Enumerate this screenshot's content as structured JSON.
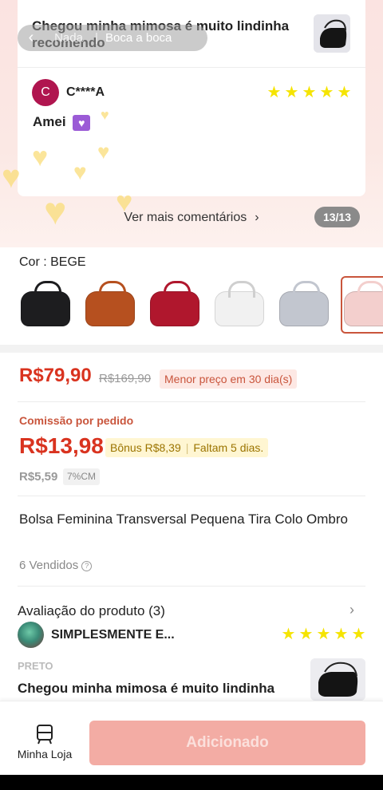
{
  "header_tabs": {
    "back_icon": "chevron-left-icon",
    "tab1": "Nada",
    "tab2": "Boca a boca"
  },
  "top_review": {
    "title": "Chegou minha mimosa é muito lindinha recomendo"
  },
  "comment": {
    "avatar_letter": "C",
    "user": "C****A",
    "rating": 5,
    "text": "Amei",
    "emoji": "purple-heart-icon"
  },
  "see_more": {
    "label": "Ver mais comentários",
    "counter": "13/13"
  },
  "color": {
    "label": "Cor : BEGE",
    "swatches": [
      {
        "name": "preto",
        "color": "#1d1d1f"
      },
      {
        "name": "marrom",
        "color": "#b6501f"
      },
      {
        "name": "vermelho",
        "color": "#b0172d"
      },
      {
        "name": "branco",
        "color": "#f1f1f1"
      },
      {
        "name": "cinza",
        "color": "#c2c6cf"
      },
      {
        "name": "bege",
        "color": "#f3cfcd",
        "selected": true
      }
    ]
  },
  "pricing": {
    "price": "R$79,90",
    "old_price": "R$169,90",
    "lowest_badge": "Menor preço em 30 dia(s)",
    "commission_label": "Comissão por pedido",
    "commission_value": "R$13,98",
    "bonus": "Bônus R$8,39",
    "deadline": "Faltam 5 dias.",
    "commission_base": "R$5,59",
    "commission_pct": "7%CM"
  },
  "product": {
    "title": "Bolsa Feminina Transversal Pequena Tira Colo Ombro",
    "sold": "6 Vendidos"
  },
  "ratings": {
    "title": "Avaliação do produto (3)",
    "review": {
      "user": "SIMPLESMENTE E...",
      "rating": 5,
      "variant": "PRETO",
      "text": "Chegou minha mimosa é muito lindinha"
    }
  },
  "bottom_bar": {
    "store_label": "Minha Loja",
    "add_label": "Adicionado"
  },
  "colors": {
    "accent": "#d9331f",
    "star": "#f5e400",
    "button_disabled": "#f3aca4"
  }
}
